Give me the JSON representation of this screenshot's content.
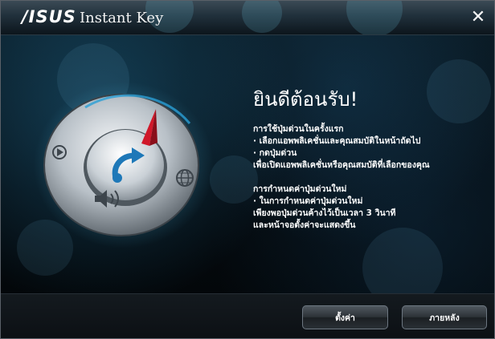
{
  "titlebar": {
    "logo_text": "/ISUS",
    "app_title": "Instant Key",
    "close_icon": "close-icon"
  },
  "main": {
    "welcome_title": "ยินดีต้อนรับ!",
    "first_use": {
      "heading": "การใช้ปุ่มด่วนในครั้งแรก",
      "lines": [
        "· เลือกแอพพลิเคชั่นและคุณสมบัติในหน้าถัดไป",
        "· กดปุ่มด่วน",
        "เพื่อเปิดแอพพลิเคชั่นหรือคุณสมบัติที่เลือกของคุณ"
      ]
    },
    "redefine": {
      "heading": "การกำหนดค่าปุ่มด่วนใหม่",
      "lines": [
        "· ในการกำหนดค่าปุ่มด่วนใหม่",
        "เพียงพอปุ่มด่วนค้างไว้เป็นเวลา 3 วินาที",
        "และหน้าจอตั้งค่าจะแสดงขึ้น"
      ]
    }
  },
  "dial": {
    "center_icon": "touch-arrow-icon",
    "left_icon": "play-icon",
    "right_icon": "globe-icon",
    "bottom_icon": "speaker-icon",
    "pointer_icon": "compass-needle-icon"
  },
  "footer": {
    "settings_label": "ตั้งค่า",
    "later_label": "ภายหลัง"
  },
  "colors": {
    "accent_blue": "#2a9fd6",
    "needle_red": "#d0182a",
    "text": "#ffffff"
  }
}
